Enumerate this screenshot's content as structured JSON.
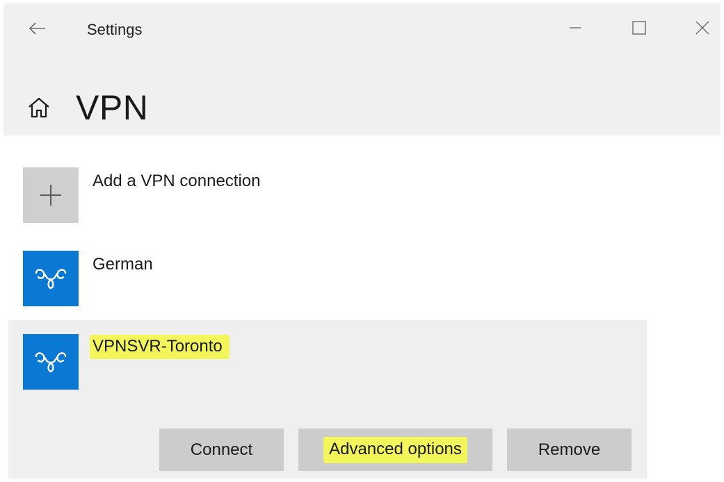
{
  "window": {
    "title": "Settings",
    "controls": [
      "minimize",
      "maximize",
      "close"
    ]
  },
  "page": {
    "title": "VPN"
  },
  "add_connection": {
    "label": "Add a VPN connection",
    "icon": "plus-icon"
  },
  "connections": [
    {
      "name": "German",
      "icon": "vpn-icon",
      "selected": false,
      "highlighted": false
    },
    {
      "name": "VPNSVR-Toronto",
      "icon": "vpn-icon",
      "selected": true,
      "highlighted": true
    }
  ],
  "actions": {
    "connect": "Connect",
    "advanced": "Advanced options",
    "remove": "Remove"
  },
  "colors": {
    "accent": "#0b78d4",
    "highlight": "#f3f65a",
    "header_bg": "#f0f0f0",
    "tile_bg": "#cfcfcf",
    "button_bg": "#cccccc",
    "selected_bg": "#efefef"
  }
}
